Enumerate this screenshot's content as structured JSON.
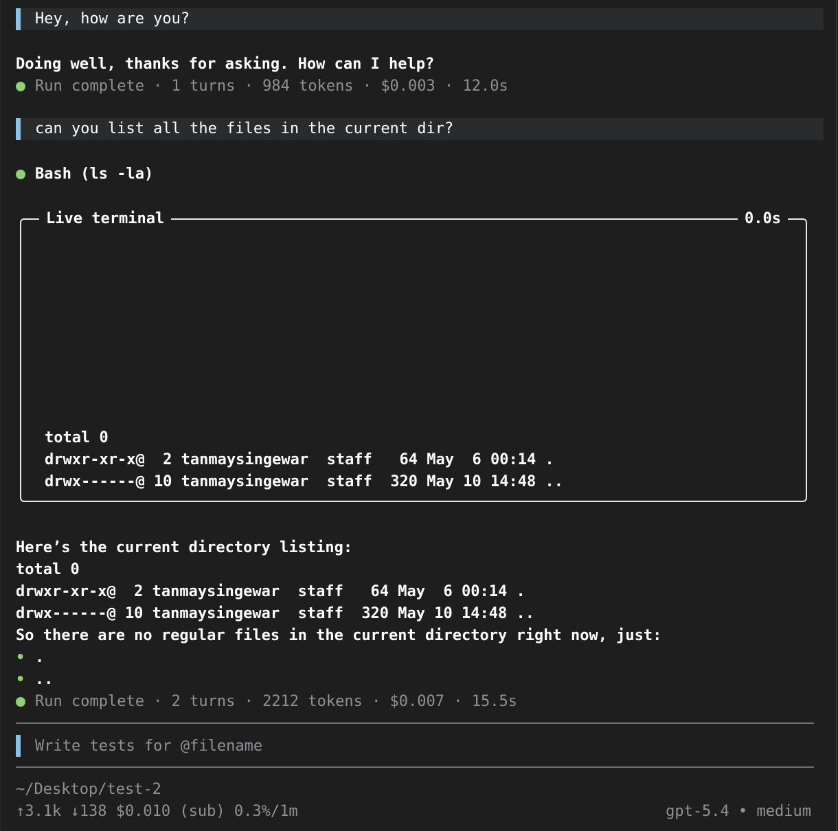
{
  "conversation": {
    "msg1_user": "Hey, how are you?",
    "msg1_reply": "Doing well, thanks for asking. How can I help?",
    "msg1_status": "Run complete · 1 turns · 984 tokens · $0.003 · 12.0s",
    "msg2_user": "can you list all the files in the current dir?",
    "tool_call": "Bash (ls -la)",
    "terminal": {
      "title": "Live terminal",
      "elapsed": "0.0s",
      "lines": [
        "total 0",
        "drwxr-xr-x@  2 tanmaysingewar  staff   64 May  6 00:14 .",
        "drwx------@ 10 tanmaysingewar  staff  320 May 10 14:48 .."
      ]
    },
    "reply2": {
      "intro": "Here’s the current directory listing:",
      "lines": [
        "total 0",
        "drwxr-xr-x@  2 tanmaysingewar  staff   64 May  6 00:14 .",
        "drwx------@ 10 tanmaysingewar  staff  320 May 10 14:48 .."
      ],
      "summary": "So there are no regular files in the current directory right now, just:",
      "bullet_glyph": "•",
      "bullets": [
        ".",
        ".."
      ]
    },
    "msg2_status": "Run complete · 2 turns · 2212 tokens · $0.007 · 15.5s"
  },
  "input": {
    "placeholder": "Write tests for @filename",
    "value": ""
  },
  "statusbar": {
    "cwd": "~/Desktop/test-2",
    "usage": "↑3.1k ↓138 $0.010 (sub) 0.3%/1m",
    "model": "gpt-5.4 • medium"
  },
  "colors": {
    "background": "#1e1e1f",
    "accent_bar": "#7fc6f2",
    "status_dot": "#8fd173",
    "dim_text": "#8e9297"
  }
}
